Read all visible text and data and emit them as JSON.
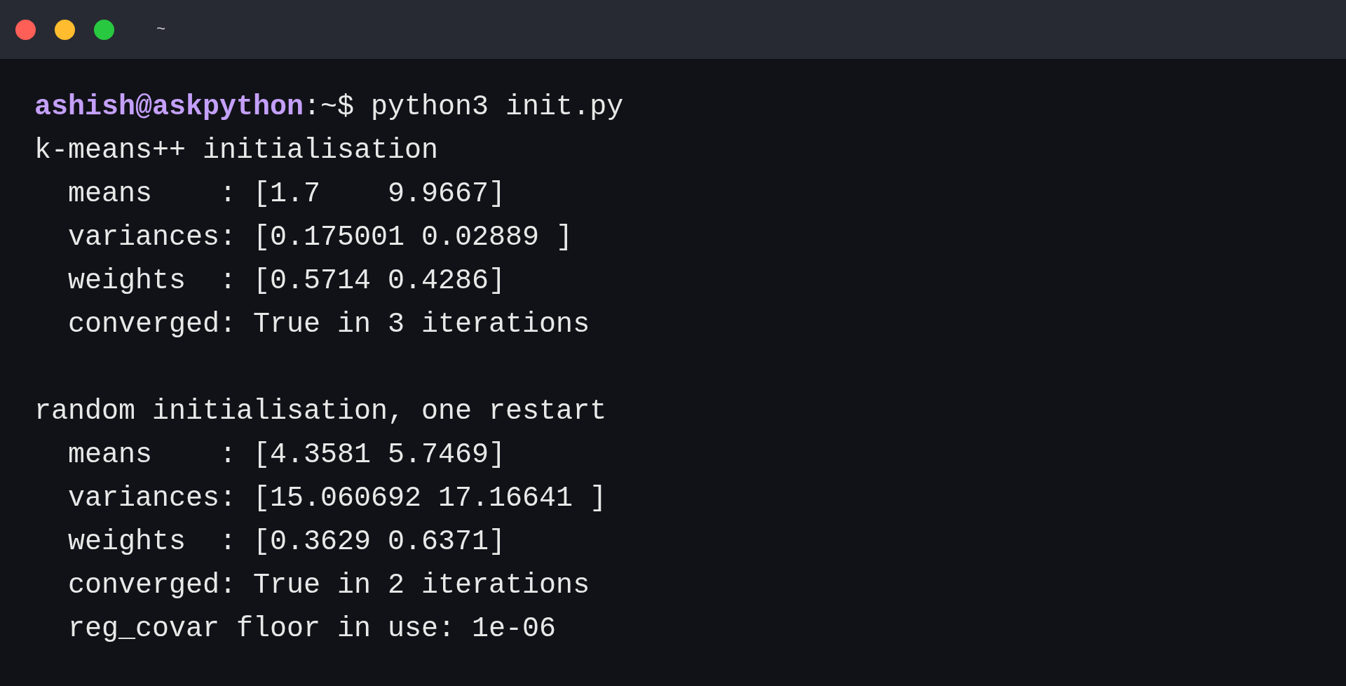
{
  "window": {
    "title": "~"
  },
  "prompt": {
    "user_host": "ashish@askpython",
    "path": ":~$",
    "command": "python3 init.py"
  },
  "output_blocks": [
    {
      "lines": [
        "k-means++ initialisation",
        "  means    : [1.7    9.9667]",
        "  variances: [0.175001 0.02889 ]",
        "  weights  : [0.5714 0.4286]",
        "  converged: True in 3 iterations"
      ]
    },
    {
      "lines": [
        "random initialisation, one restart",
        "  means    : [4.3581 5.7469]",
        "  variances: [15.060692 17.16641 ]",
        "  weights  : [0.3629 0.6371]",
        "  converged: True in 2 iterations",
        "  reg_covar floor in use: 1e-06"
      ]
    }
  ]
}
